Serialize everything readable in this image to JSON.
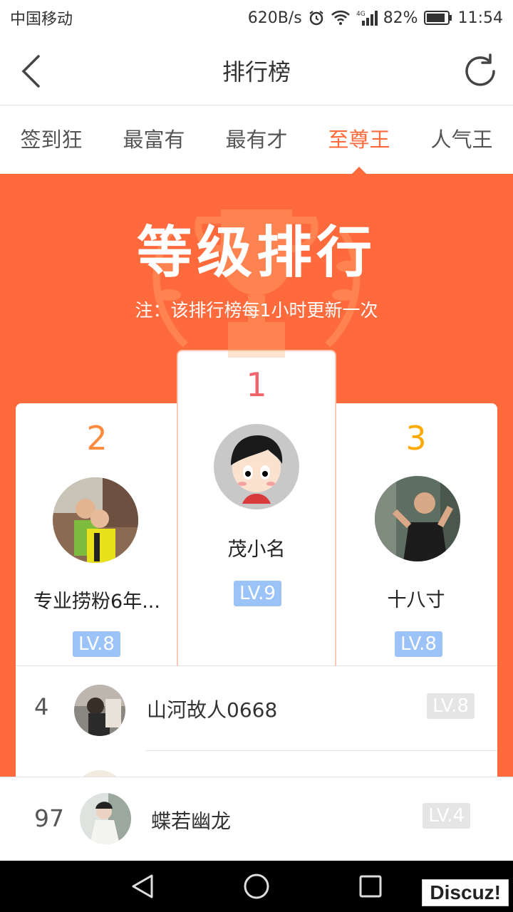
{
  "status_bar": {
    "carrier": "中国移动",
    "speed": "620B/s",
    "network": "4G",
    "battery": "82%",
    "time": "11:54"
  },
  "navbar": {
    "title": "排行榜",
    "back_icon": "chevron-left-icon",
    "refresh_icon": "refresh-icon"
  },
  "tabs": [
    {
      "label": "签到狂",
      "active": false
    },
    {
      "label": "最富有",
      "active": false
    },
    {
      "label": "最有才",
      "active": false
    },
    {
      "label": "至尊王",
      "active": true
    },
    {
      "label": "人气王",
      "active": false
    }
  ],
  "banner": {
    "title": "等级排行",
    "note": "注：该排行榜每1小时更新一次",
    "background": "#ff6a3c"
  },
  "podium": {
    "first": {
      "rank": "1",
      "name": "茂小名",
      "level": "LV.9",
      "rank_color": "#f2646b"
    },
    "second": {
      "rank": "2",
      "name": "专业捞粉6年...",
      "level": "LV.8",
      "rank_color": "#ff8a3d"
    },
    "third": {
      "rank": "3",
      "name": "十八寸",
      "level": "LV.8",
      "rank_color": "#ffaa00"
    }
  },
  "list": [
    {
      "rank": "4",
      "name": "山河故人0668",
      "level": "LV.8"
    }
  ],
  "my_rank": {
    "rank": "97",
    "name": "蝶若幽龙",
    "level": "LV.4"
  },
  "watermark": "Discuz!",
  "colors": {
    "accent": "#ff6a3c",
    "level_badge": "#9cc3f7",
    "level_badge_gray": "#e5e5e5"
  }
}
